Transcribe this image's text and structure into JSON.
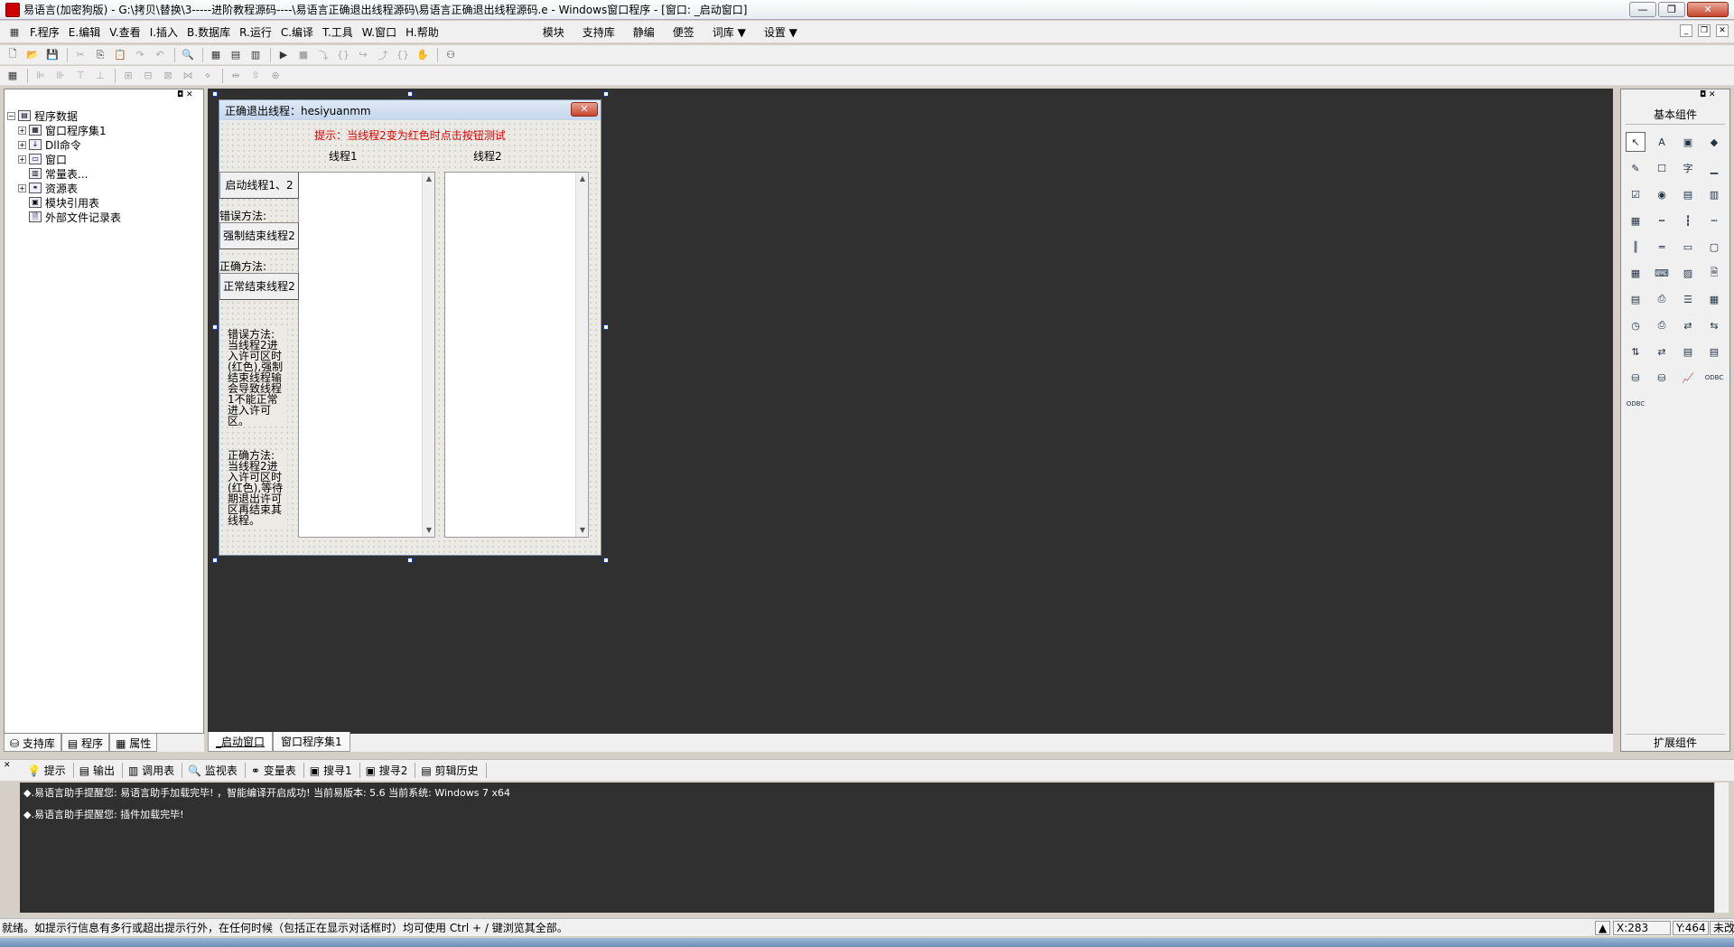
{
  "window": {
    "title": "易语言(加密狗版) - G:\\拷贝\\替换\\3-----进阶教程源码----\\易语言正确退出线程源码\\易语言正确退出线程源码.e - Windows窗口程序 - [窗口: _启动窗口]"
  },
  "menubar": {
    "items": [
      "F.程序",
      "E.编辑",
      "V.查看",
      "I.插入",
      "B.数据库",
      "R.运行",
      "C.编译",
      "T.工具",
      "W.窗口",
      "H.帮助"
    ],
    "extra": [
      "模块",
      "支持库",
      "静编",
      "便签",
      "词库 ▼",
      "设置 ▼"
    ]
  },
  "left_panel": {
    "tree": [
      {
        "label": "程序数据",
        "level": 0,
        "expander": "−"
      },
      {
        "label": "窗口程序集1",
        "level": 1,
        "expander": "+"
      },
      {
        "label": "Dll命令",
        "level": 1,
        "expander": "+"
      },
      {
        "label": "窗口",
        "level": 1,
        "expander": "+"
      },
      {
        "label": "常量表...",
        "level": 1,
        "expander": ""
      },
      {
        "label": "资源表",
        "level": 1,
        "expander": "+"
      },
      {
        "label": "模块引用表",
        "level": 1,
        "expander": ""
      },
      {
        "label": "外部文件记录表",
        "level": 1,
        "expander": ""
      }
    ],
    "tabs": [
      "支持库",
      "程序",
      "属性"
    ]
  },
  "form": {
    "title": "正确退出线程：hesiyuanmm",
    "hint": "提示：当线程2变为红色时点击按钮测试",
    "col1": "线程1",
    "col2": "线程2",
    "btn_start": "启动线程1、2",
    "label_wrong": "错误方法:",
    "btn_force": "强制结束线程2",
    "label_right": "正确方法:",
    "btn_normal": "正常结束线程2",
    "note_wrong": "错误方法:   当线程2进入许可区时(红色),强制结束线程输会导致线程1不能正常进入许可区。",
    "note_right": "正确方法:   当线程2进入许可区时(红色),等待期退出许可区再结束其线程。"
  },
  "design_tabs": [
    "_启动窗口",
    "窗口程序集1"
  ],
  "right_panel": {
    "header": "基本组件",
    "footer": "扩展组件",
    "components": [
      "pointer-icon",
      "label-icon",
      "picture-icon",
      "shape-icon",
      "edit-icon",
      "checkbox-icon",
      "char-icon",
      "line-icon",
      "checkmark-icon",
      "radio-icon",
      "listview-icon",
      "combo-icon",
      "grid-icon",
      "ruler-icon",
      "scrollbar-icon",
      "hscroll-icon",
      "vscroll-icon",
      "slider-icon",
      "tab-icon",
      "frame-icon",
      "calendar-icon",
      "hotkey-icon",
      "folder-icon",
      "file-icon",
      "table-icon",
      "tray-icon",
      "tree-icon",
      "panel-icon",
      "timer-icon",
      "printer-icon",
      "net-icon",
      "socket-icon",
      "client-icon",
      "server-icon",
      "layout-icon",
      "richedit-icon",
      "db-icon",
      "db2-icon",
      "chart-icon",
      "odbc-icon",
      "odbc2-icon"
    ],
    "component_glyphs": [
      "↖",
      "A",
      "▣",
      "◆",
      "✎",
      "☐",
      "字",
      "▁",
      "☑",
      "◉",
      "▤",
      "▥",
      "▦",
      "┅",
      "┇",
      "┉",
      "║",
      "═",
      "▭",
      "▢",
      "▦",
      "⌨",
      "▨",
      "🗎",
      "▤",
      "⎙",
      "☰",
      "▦",
      "◷",
      "⎙",
      "⇄",
      "⇆",
      "⇅",
      "⇄",
      "▤",
      "▤",
      "⛁",
      "⛁",
      "📈",
      "ODBC",
      "ODBC"
    ]
  },
  "output_panel": {
    "tabs": [
      "提示",
      "输出",
      "调用表",
      "监视表",
      "变量表",
      "搜寻1",
      "搜寻2",
      "剪辑历史"
    ],
    "lines": [
      "◆.易语言助手提醒您:  易语言助手加载完毕!  ，智能编译开启成功!  当前易版本: 5.6  当前系统: Windows 7 x64",
      "◆.易语言助手提醒您: 插件加载完毕!"
    ]
  },
  "statusbar": {
    "text": "就绪。如提示行信息有多行或超出提示行外，在任何时候（包括正在显示对话框时）均可使用 Ctrl + / 键浏览其全部。",
    "x": "X:283",
    "y": "Y:464",
    "mod": "未改"
  }
}
